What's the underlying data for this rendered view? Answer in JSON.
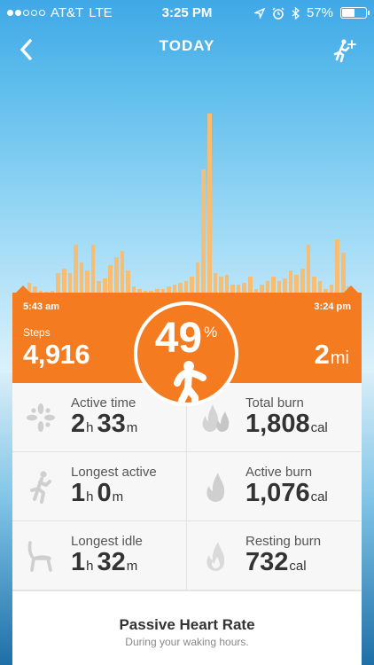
{
  "status_bar": {
    "signal_dots": [
      true,
      true,
      false,
      false,
      false
    ],
    "carrier": "AT&T",
    "network": "LTE",
    "time": "3:25 PM",
    "battery_percent": "57%",
    "battery_level": 0.57,
    "icons": [
      "location-arrow-icon",
      "alarm-clock-icon",
      "bluetooth-icon"
    ]
  },
  "nav": {
    "title": "TODAY",
    "back_icon": "chevron-left-icon",
    "action_icon": "add-activity-icon"
  },
  "chart_data": {
    "type": "bar",
    "x_start": "5:43 am",
    "x_end": "3:24 pm",
    "values": [
      2,
      5,
      3,
      1,
      0,
      1,
      10,
      12,
      10,
      24,
      15,
      11,
      24,
      6,
      7,
      14,
      18,
      21,
      11,
      3,
      2,
      1,
      1,
      2,
      2,
      3,
      4,
      5,
      6,
      8,
      15,
      62,
      90,
      10,
      8,
      9,
      4,
      4,
      5,
      8,
      2,
      4,
      6,
      8,
      6,
      7,
      11,
      9,
      12,
      24,
      8,
      6,
      2,
      4,
      27,
      20,
      3
    ],
    "ylim": [
      0,
      100
    ],
    "color": "#f6be75"
  },
  "summary": {
    "time_start": "5:43 am",
    "time_end": "3:24 pm",
    "steps_label": "Steps",
    "steps_value": "4,916",
    "goal_percent": "49",
    "goal_suffix": "%",
    "distance_value": "2",
    "distance_unit": "mi",
    "accent_color": "#f47b20"
  },
  "stats": {
    "active_time": {
      "label": "Active time",
      "v1": "2",
      "u1": "h",
      "v2": "33",
      "u2": "m",
      "icon": "sparkle-icon"
    },
    "longest_active": {
      "label": "Longest active",
      "v1": "1",
      "u1": "h",
      "v2": "0",
      "u2": "m",
      "icon": "running-person-icon"
    },
    "longest_idle": {
      "label": "Longest idle",
      "v1": "1",
      "u1": "h",
      "v2": "32",
      "u2": "m",
      "icon": "chair-icon"
    },
    "total_burn": {
      "label": "Total burn",
      "value": "1,808",
      "unit": "cal",
      "icon": "double-flame-icon"
    },
    "active_burn": {
      "label": "Active burn",
      "value": "1,076",
      "unit": "cal",
      "icon": "flame-icon"
    },
    "resting_burn": {
      "label": "Resting burn",
      "value": "732",
      "unit": "cal",
      "icon": "flame-outline-icon"
    }
  },
  "passive_heart_rate": {
    "title": "Passive Heart Rate",
    "subtitle": "During your waking hours."
  }
}
